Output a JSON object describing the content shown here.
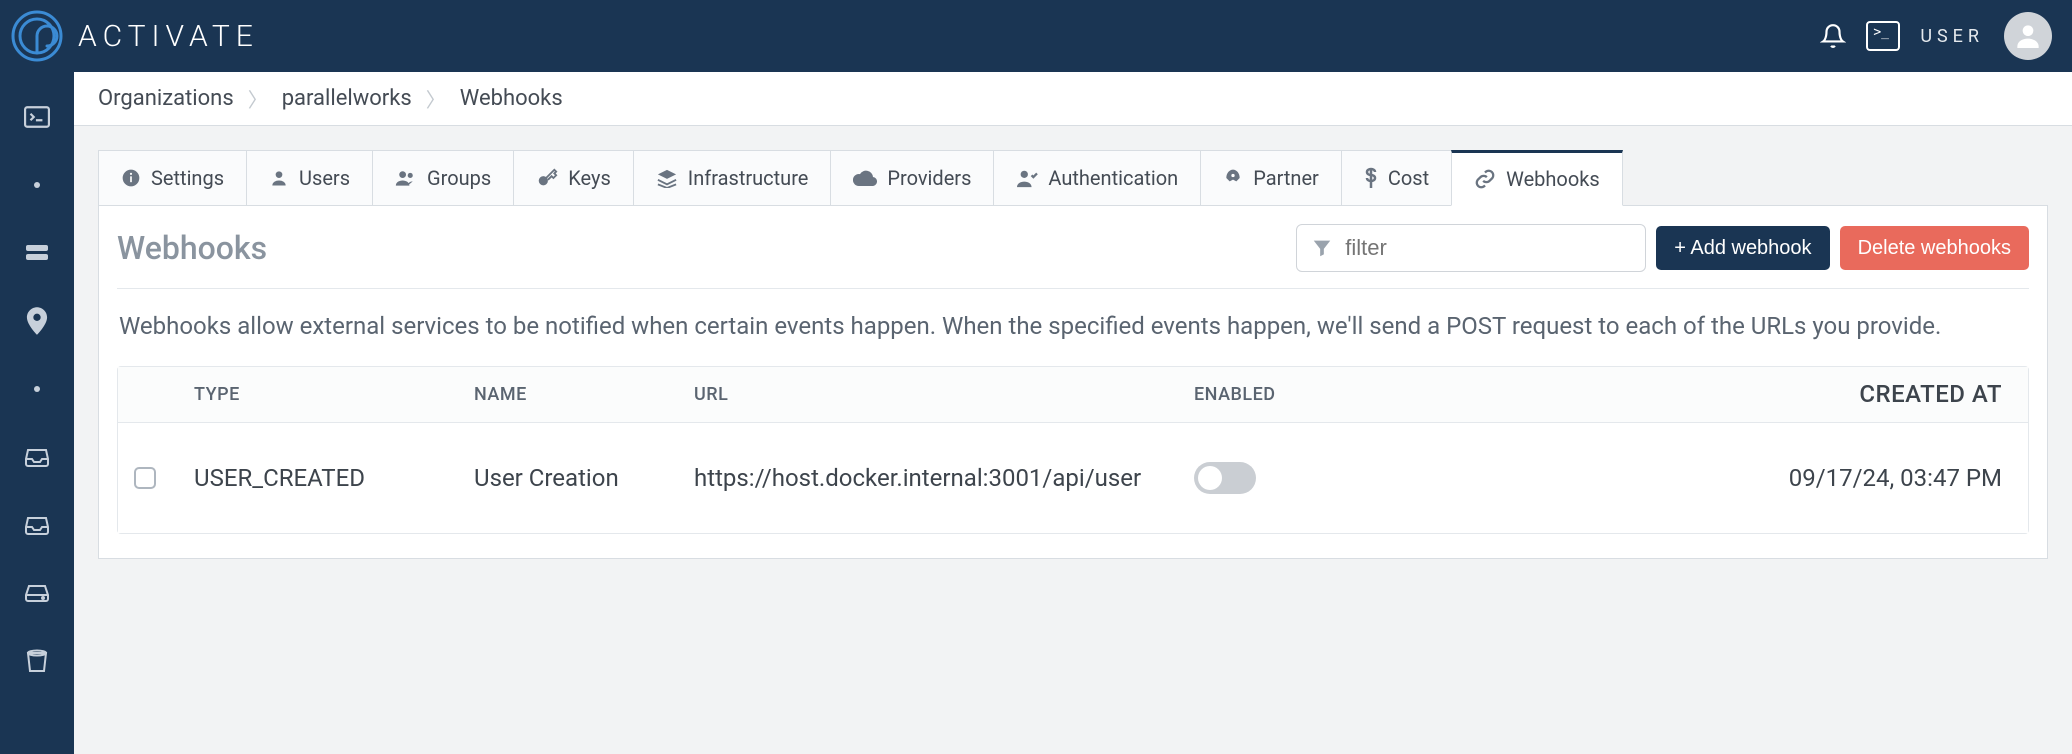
{
  "brand": "ACTIVATE",
  "header": {
    "user_label": "USER"
  },
  "breadcrumbs": [
    "Organizations",
    "parallelworks",
    "Webhooks"
  ],
  "tabs": [
    {
      "label": "Settings",
      "icon": "info"
    },
    {
      "label": "Users",
      "icon": "user"
    },
    {
      "label": "Groups",
      "icon": "users"
    },
    {
      "label": "Keys",
      "icon": "key"
    },
    {
      "label": "Infrastructure",
      "icon": "layers"
    },
    {
      "label": "Providers",
      "icon": "cloud"
    },
    {
      "label": "Authentication",
      "icon": "auth"
    },
    {
      "label": "Partner",
      "icon": "rocket"
    },
    {
      "label": "Cost",
      "icon": "dollar"
    },
    {
      "label": "Webhooks",
      "icon": "link",
      "active": true
    }
  ],
  "panel": {
    "title": "Webhooks",
    "filter_placeholder": "filter",
    "add_button": "+ Add webhook",
    "delete_button": "Delete webhooks",
    "description": "Webhooks allow external services to be notified when certain events happen. When the specified events happen, we'll send a POST request to each of the URLs you provide."
  },
  "table": {
    "columns": [
      "TYPE",
      "NAME",
      "URL",
      "ENABLED",
      "CREATED AT"
    ],
    "rows": [
      {
        "type": "USER_CREATED",
        "name": "User Creation",
        "url": "https://host.docker.internal:3001/api/user",
        "enabled": false,
        "created_at": "09/17/24, 03:47 PM"
      }
    ]
  }
}
